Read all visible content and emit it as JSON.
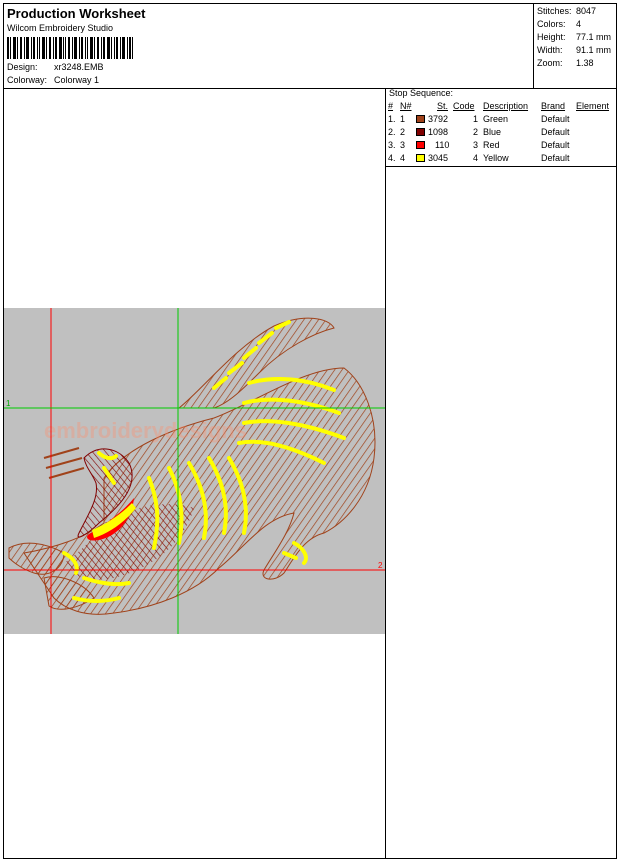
{
  "header": {
    "title": "Production Worksheet",
    "app_name": "Wilcom Embroidery Studio",
    "design_label": "Design:",
    "design_value": "xr3248.EMB",
    "colorway_label": "Colorway:",
    "colorway_value": "Colorway 1"
  },
  "stats": [
    {
      "label": "Stitches:",
      "value": "8047"
    },
    {
      "label": "Colors:",
      "value": "4"
    },
    {
      "label": "Height:",
      "value": "77.1 mm"
    },
    {
      "label": "Width:",
      "value": "91.1 mm"
    },
    {
      "label": "Zoom:",
      "value": "1.38"
    }
  ],
  "stop_sequence": {
    "title": "Stop Sequence:",
    "headers": {
      "num": "#",
      "n": "N#",
      "st": "St.",
      "code": "Code",
      "description": "Description",
      "brand": "Brand",
      "element": "Element"
    },
    "rows": [
      {
        "num": "1.",
        "n": "1",
        "color": "#a0421a",
        "st": "3792",
        "code": "1",
        "description": "Green",
        "brand": "Default"
      },
      {
        "num": "2.",
        "n": "2",
        "color": "#800000",
        "st": "1098",
        "code": "2",
        "description": "Blue",
        "brand": "Default"
      },
      {
        "num": "3.",
        "n": "3",
        "color": "#ff0000",
        "st": "110",
        "code": "3",
        "description": "Red",
        "brand": "Default"
      },
      {
        "num": "4.",
        "n": "4",
        "color": "#ffff00",
        "st": "3045",
        "code": "4",
        "description": "Yellow",
        "brand": "Default"
      }
    ]
  },
  "preview": {
    "marker_1": "1",
    "marker_2": "2",
    "watermark": "embroiderydesigns",
    "background": "#c0c0c0",
    "guide_red": "#ff0000",
    "guide_green": "#00cc00"
  }
}
